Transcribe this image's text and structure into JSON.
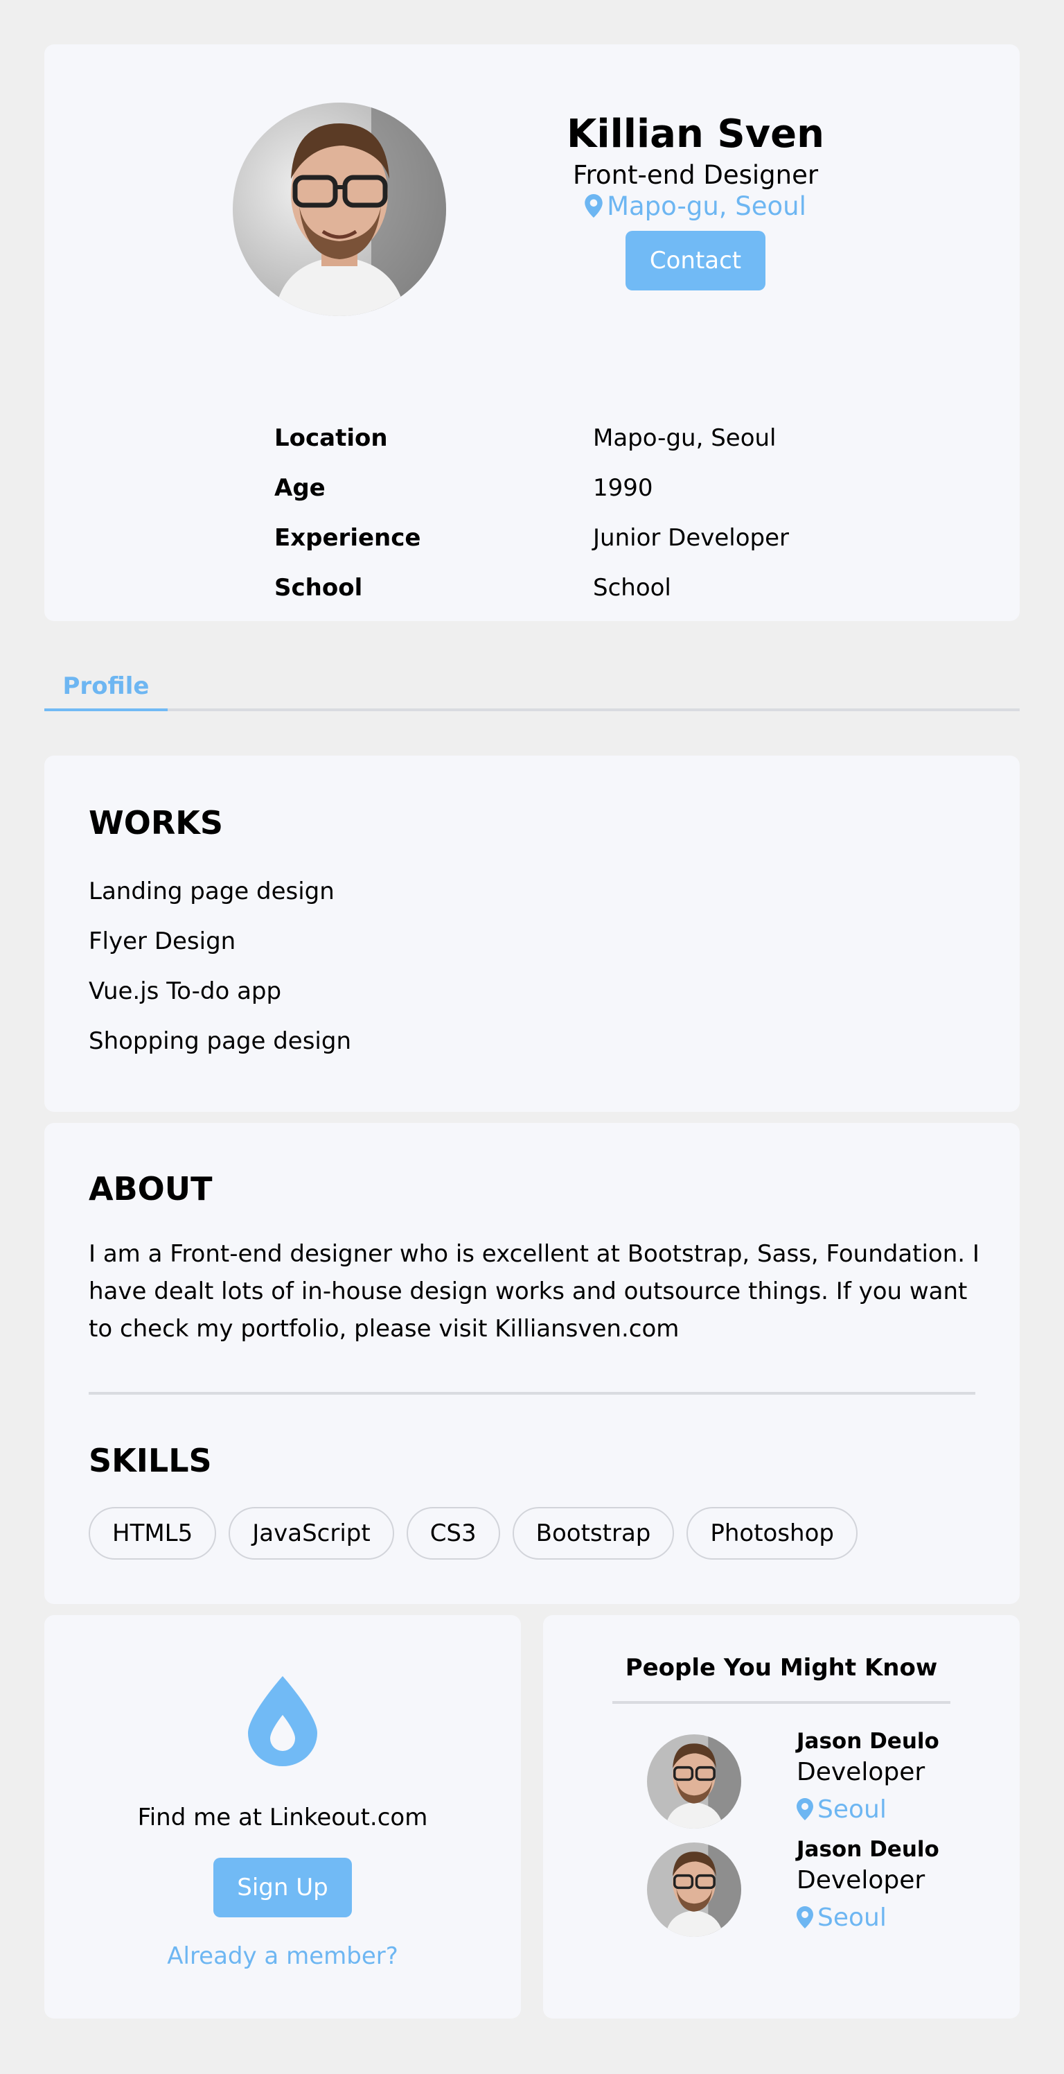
{
  "profile": {
    "name": "Killian Sven",
    "role": "Front-end Designer",
    "location": "Mapo-gu, Seoul",
    "contact_label": "Contact",
    "details": [
      {
        "key": "Location",
        "value": "Mapo-gu, Seoul"
      },
      {
        "key": "Age",
        "value": "1990"
      },
      {
        "key": "Experience",
        "value": "Junior Developer"
      },
      {
        "key": "School",
        "value": "School"
      }
    ]
  },
  "tabs": [
    {
      "label": "Profile",
      "active": true
    }
  ],
  "works": {
    "title": "WORKS",
    "items": [
      "Landing page design",
      "Flyer Design",
      "Vue.js To-do app",
      "Shopping page design"
    ]
  },
  "about": {
    "title": "ABOUT",
    "text": "I am a Front-end designer who is excellent at Bootstrap, Sass, Foundation. I have dealt lots of in-house design works and outsource things. If you want to check my portfolio, please visit Killiansven.com"
  },
  "skills": {
    "title": "SKILLS",
    "items": [
      "HTML5",
      "JavaScript",
      "CS3",
      "Bootstrap",
      "Photoshop"
    ]
  },
  "linkeout": {
    "icon": "water-drop-icon",
    "text": "Find me at Linkeout.com",
    "signup_label": "Sign Up",
    "member_link": "Already a member?"
  },
  "people": {
    "title": "People You Might Know",
    "items": [
      {
        "name": "Jason Deulo",
        "role": "Developer",
        "location": "Seoul"
      },
      {
        "name": "Jason Deulo",
        "role": "Developer",
        "location": "Seoul"
      }
    ]
  },
  "colors": {
    "accent": "#71baf5",
    "card": "#f6f7fb",
    "background": "#efefef"
  }
}
